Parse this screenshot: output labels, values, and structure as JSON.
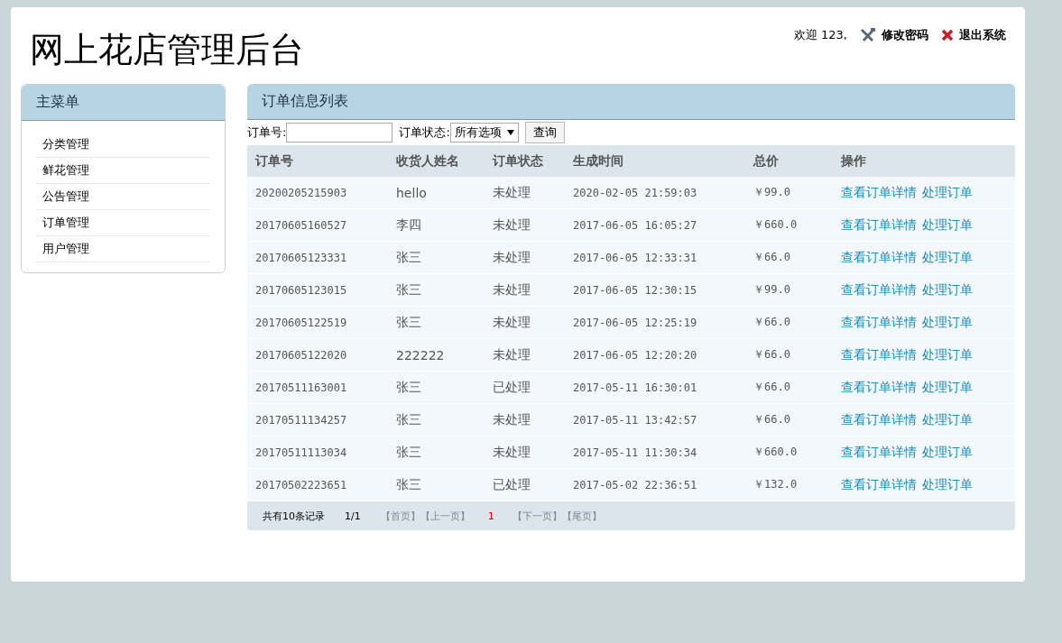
{
  "header": {
    "title": "网上花店管理后台",
    "welcome": "欢迎 123,",
    "links": [
      {
        "kind": "tools",
        "label": "修改密码"
      },
      {
        "kind": "close",
        "label": "退出系统"
      }
    ]
  },
  "sidebar": {
    "title": "主菜单",
    "items": [
      "分类管理",
      "鲜花管理",
      "公告管理",
      "订单管理",
      "用户管理"
    ]
  },
  "panel": {
    "title": "订单信息列表",
    "filter": {
      "order_label": "订单号:",
      "status_label": "订单状态:",
      "status_value": "所有选项",
      "button": "查询"
    },
    "table": {
      "columns": [
        "订单号",
        "收货人姓名",
        "订单状态",
        "生成时间",
        "总价",
        "操作"
      ],
      "rows": [
        {
          "cells": [
            "20200205215903",
            "hello",
            "未处理",
            "2020-02-05 21:59:03",
            "￥99.0"
          ],
          "actions": [
            "查看订单详情",
            "处理订单"
          ]
        },
        {
          "cells": [
            "20170605160527",
            "李四",
            "未处理",
            "2017-06-05 16:05:27",
            "￥660.0"
          ],
          "actions": [
            "查看订单详情",
            "处理订单"
          ]
        },
        {
          "cells": [
            "20170605123331",
            "张三",
            "未处理",
            "2017-06-05 12:33:31",
            "￥66.0"
          ],
          "actions": [
            "查看订单详情",
            "处理订单"
          ]
        },
        {
          "cells": [
            "20170605123015",
            "张三",
            "未处理",
            "2017-06-05 12:30:15",
            "￥99.0"
          ],
          "actions": [
            "查看订单详情",
            "处理订单"
          ]
        },
        {
          "cells": [
            "20170605122519",
            "张三",
            "未处理",
            "2017-06-05 12:25:19",
            "￥66.0"
          ],
          "actions": [
            "查看订单详情",
            "处理订单"
          ]
        },
        {
          "cells": [
            "20170605122020",
            "222222",
            "未处理",
            "2017-06-05 12:20:20",
            "￥66.0"
          ],
          "actions": [
            "查看订单详情",
            "处理订单"
          ]
        },
        {
          "cells": [
            "20170511163001",
            "张三",
            "已处理",
            "2017-05-11 16:30:01",
            "￥66.0"
          ],
          "actions": [
            "查看订单详情",
            "处理订单"
          ]
        },
        {
          "cells": [
            "20170511134257",
            "张三",
            "未处理",
            "2017-05-11 13:42:57",
            "￥66.0"
          ],
          "actions": [
            "查看订单详情",
            "处理订单"
          ]
        },
        {
          "cells": [
            "20170511113034",
            "张三",
            "未处理",
            "2017-05-11 11:30:34",
            "￥660.0"
          ],
          "actions": [
            "查看订单详情",
            "处理订单"
          ]
        },
        {
          "cells": [
            "20170502223651",
            "张三",
            "已处理",
            "2017-05-02 22:36:51",
            "￥132.0"
          ],
          "actions": [
            "查看订单详情",
            "处理订单"
          ]
        }
      ]
    },
    "pager": {
      "total": "共有10条记录",
      "page": "1/1",
      "items": [
        {
          "kind": "link",
          "label": "【首页】",
          "disabled": true
        },
        {
          "kind": "link",
          "label": "【上一页】",
          "disabled": true
        },
        {
          "kind": "page",
          "label": "1",
          "selected": true
        },
        {
          "kind": "link",
          "label": "【下一页】",
          "disabled": true
        },
        {
          "kind": "link",
          "label": "【尾页】",
          "disabled": true
        }
      ]
    }
  }
}
